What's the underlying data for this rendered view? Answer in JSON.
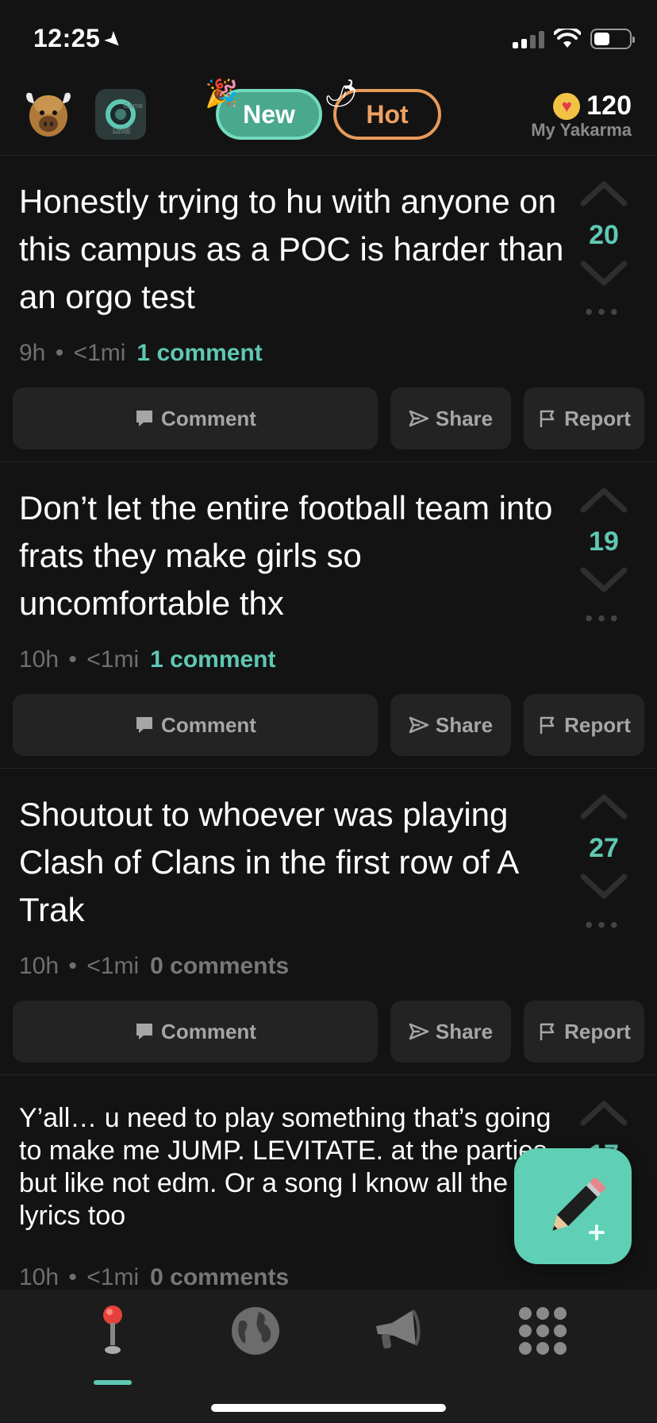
{
  "status": {
    "time": "12:25"
  },
  "header": {
    "tab_new": "New",
    "tab_hot": "Hot",
    "karma_value": "120",
    "karma_label": "My Yakarma",
    "legal_top": "Game",
    "legal_bottom": "Legal"
  },
  "posts": [
    {
      "text": "Honestly trying to hu with anyone on this campus as a POC is harder than an orgo test",
      "age": "9h",
      "distance": "<1mi",
      "comments": "1 comment",
      "votes": "20"
    },
    {
      "text": "Don’t let the entire football team into frats they make girls so uncomfortable thx",
      "age": "10h",
      "distance": "<1mi",
      "comments": "1 comment",
      "votes": "19"
    },
    {
      "text": "Shoutout to whoever was playing Clash of Clans in the first row of A Trak",
      "age": "10h",
      "distance": "<1mi",
      "comments": "0 comments",
      "votes": "27"
    },
    {
      "text": "Y’all… u need to play something that’s going to make me JUMP. LEVITATE. at the parties but like not edm. Or a song I know all the lyrics too",
      "age": "10h",
      "distance": "<1mi",
      "comments": "0 comments",
      "votes": "17"
    }
  ],
  "actions": {
    "comment": "Comment",
    "share": "Share",
    "report": "Report"
  },
  "nav": {
    "items": [
      "joystick-icon",
      "globe-icon",
      "megaphone-icon",
      "grid-icon"
    ],
    "active": 0
  },
  "colors": {
    "accent": "#5fc8b3",
    "hot": "#f0a060",
    "background": "#131313"
  }
}
